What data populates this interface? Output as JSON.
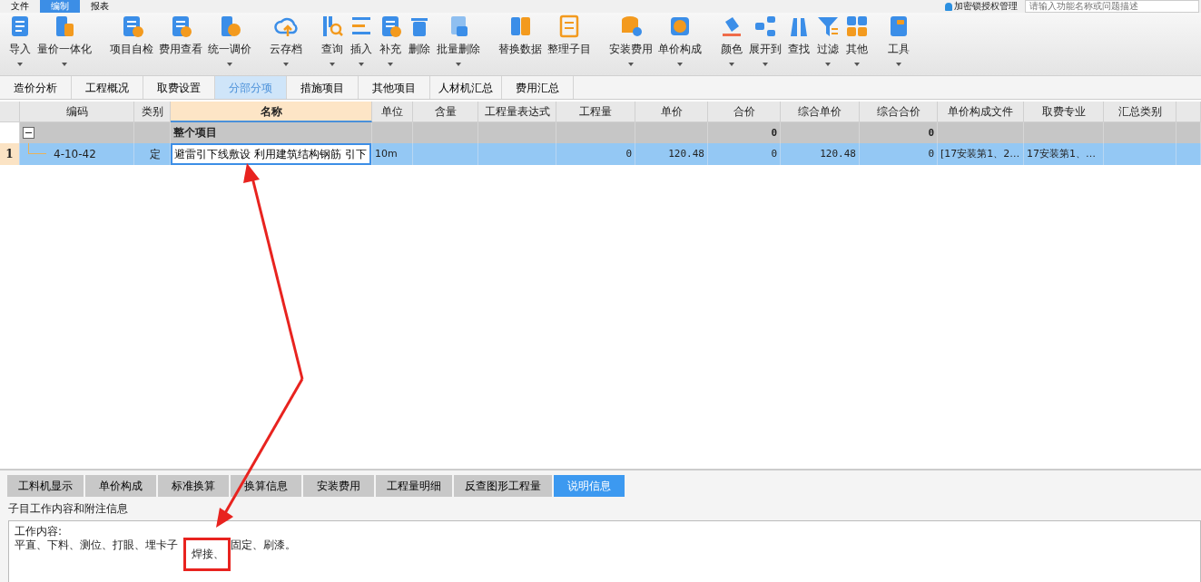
{
  "menu": {
    "items": [
      {
        "label": "文件",
        "selected": false
      },
      {
        "label": "编制",
        "selected": true
      },
      {
        "label": "报表",
        "selected": false
      }
    ],
    "account": "加密锁授权管理",
    "search": {
      "placeholder": "请输入功能名称或问题描述"
    }
  },
  "toolbar": {
    "groups": [
      [
        {
          "label": "导入",
          "dropdown": true
        },
        {
          "label": "量价一体化",
          "dropdown": true
        }
      ],
      [
        {
          "label": "项目自检",
          "dropdown": false
        },
        {
          "label": "费用查看",
          "dropdown": false
        },
        {
          "label": "统一调价",
          "dropdown": true
        }
      ],
      [
        {
          "label": "云存档",
          "dropdown": true
        }
      ],
      [
        {
          "label": "查询",
          "dropdown": true
        },
        {
          "label": "插入",
          "dropdown": true
        },
        {
          "label": "补充",
          "dropdown": true
        },
        {
          "label": "删除",
          "dropdown": false
        },
        {
          "label": "批量删除",
          "dropdown": true
        }
      ],
      [
        {
          "label": "替换数据",
          "dropdown": false
        },
        {
          "label": "整理子目",
          "dropdown": false
        }
      ],
      [
        {
          "label": "安装费用",
          "dropdown": true
        },
        {
          "label": "单价构成",
          "dropdown": true
        }
      ],
      [
        {
          "label": "颜色",
          "dropdown": true
        },
        {
          "label": "展开到",
          "dropdown": true
        },
        {
          "label": "查找",
          "dropdown": false
        },
        {
          "label": "过滤",
          "dropdown": true
        },
        {
          "label": "其他",
          "dropdown": true
        }
      ],
      [
        {
          "label": "工具",
          "dropdown": true
        }
      ]
    ]
  },
  "page_tabs": [
    {
      "label": "造价分析",
      "selected": false
    },
    {
      "label": "工程概况",
      "selected": false
    },
    {
      "label": "取费设置",
      "selected": false
    },
    {
      "label": "分部分项",
      "selected": true
    },
    {
      "label": "措施项目",
      "selected": false
    },
    {
      "label": "其他项目",
      "selected": false
    },
    {
      "label": "人材机汇总",
      "selected": false
    },
    {
      "label": "费用汇总",
      "selected": false
    }
  ],
  "table": {
    "columns": [
      {
        "label": "编码",
        "selected": false
      },
      {
        "label": "类别",
        "selected": false
      },
      {
        "label": "名称",
        "selected": true
      },
      {
        "label": "单位",
        "selected": false
      },
      {
        "label": "含量",
        "selected": false
      },
      {
        "label": "工程量表达式",
        "selected": false
      },
      {
        "label": "工程量",
        "selected": false
      },
      {
        "label": "单价",
        "selected": false
      },
      {
        "label": "合价",
        "selected": false
      },
      {
        "label": "综合单价",
        "selected": false
      },
      {
        "label": "综合合价",
        "selected": false
      },
      {
        "label": "单价构成文件",
        "selected": false
      },
      {
        "label": "取费专业",
        "selected": false
      },
      {
        "label": "汇总类别",
        "selected": false
      }
    ],
    "rows": [
      {
        "kind": "group",
        "expanded": true,
        "selected": false,
        "cells": [
          "",
          "",
          "整个项目",
          "",
          "",
          "",
          "",
          "",
          "0",
          "",
          "0",
          "",
          "",
          ""
        ]
      },
      {
        "kind": "item",
        "number": "1",
        "selected": true,
        "editing": true,
        "cells": [
          "4-10-42",
          "定",
          "避雷引下线敷设 利用建筑结构钢筋 引下",
          "10m",
          "",
          "",
          "0",
          "120.48",
          "0",
          "120.48",
          "0",
          "[17安装第1、2…",
          "17安装第1、…",
          ""
        ]
      }
    ]
  },
  "detail_tabs": [
    {
      "label": "工料机显示",
      "selected": false
    },
    {
      "label": "单价构成",
      "selected": false
    },
    {
      "label": "标准换算",
      "selected": false
    },
    {
      "label": "换算信息",
      "selected": false
    },
    {
      "label": "安装费用",
      "selected": false
    },
    {
      "label": "工程量明细",
      "selected": false
    },
    {
      "label": "反查图形工程量",
      "selected": false
    },
    {
      "label": "说明信息",
      "selected": true
    }
  ],
  "detail": {
    "title": "子目工作内容和附注信息",
    "lines": [
      [
        {
          "text": "工作内容:",
          "highlighted": false
        }
      ],
      [
        {
          "text": "平直、下料、测位、打眼、埋卡子",
          "highlighted": false
        },
        {
          "text": "焊接、",
          "highlighted": true
        },
        {
          "text": "固定、刷漆。",
          "highlighted": false
        }
      ]
    ]
  }
}
